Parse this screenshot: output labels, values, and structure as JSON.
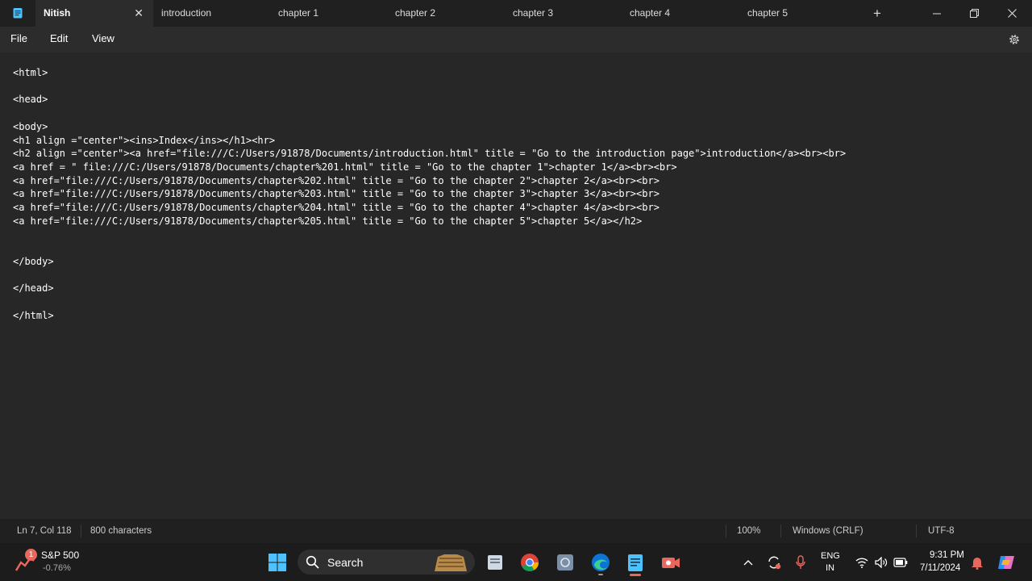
{
  "titlebar": {
    "tabs": [
      {
        "label": "Nitish",
        "active": true
      },
      {
        "label": "introduction"
      },
      {
        "label": "chapter 1"
      },
      {
        "label": "chapter 2"
      },
      {
        "label": "chapter 3"
      },
      {
        "label": "chapter 4"
      },
      {
        "label": "chapter 5"
      }
    ],
    "close_tab_glyph": "✕",
    "new_tab_glyph": "+"
  },
  "menu": {
    "file": "File",
    "edit": "Edit",
    "view": "View"
  },
  "editor": {
    "lines": [
      "<html>",
      "",
      "<head>",
      "",
      "<body>",
      "<h1 align =\"center\"><ins>Index</ins></h1><hr>",
      "<h2 align =\"center\"><a href=\"file:///C:/Users/91878/Documents/introduction.html\" title = \"Go to the introduction page\">introduction</a><br><br>",
      "<a href = \" file:///C:/Users/91878/Documents/chapter%201.html\" title = \"Go to the chapter 1\">chapter 1</a><br><br>",
      "<a href=\"file:///C:/Users/91878/Documents/chapter%202.html\" title = \"Go to the chapter 2\">chapter 2</a><br><br>",
      "<a href=\"file:///C:/Users/91878/Documents/chapter%203.html\" title = \"Go to the chapter 3\">chapter 3</a><br><br>",
      "<a href=\"file:///C:/Users/91878/Documents/chapter%204.html\" title = \"Go to the chapter 4\">chapter 4</a><br><br>",
      "<a href=\"file:///C:/Users/91878/Documents/chapter%205.html\" title = \"Go to the chapter 5\">chapter 5</a></h2>",
      "",
      "",
      "</body>",
      "",
      "</head>",
      "",
      "</html>"
    ]
  },
  "status": {
    "position": "Ln 7, Col 118",
    "characters": "800 characters",
    "zoom": "100%",
    "line_ending": "Windows (CRLF)",
    "encoding": "UTF-8"
  },
  "taskbar": {
    "stock_name": "S&P 500",
    "stock_change": "-0.76%",
    "stock_badge": "1",
    "search_label": "Search",
    "lang_top": "ENG",
    "lang_bottom": "IN",
    "time": "9:31 PM",
    "date": "7/11/2024"
  },
  "colors": {
    "accent": "#4cc2ff",
    "editor_bg": "#272727",
    "titlebar_bg": "#202020",
    "stock_negative": "#e8685e"
  },
  "icons": [
    "notepad-app-icon",
    "settings-gear-icon",
    "windows-start-icon",
    "search-icon",
    "widget-icon",
    "file-explorer-icon",
    "chrome-icon",
    "files-icon",
    "edge-icon",
    "notepad-icon",
    "recorder-icon",
    "chevron-up-icon",
    "sync-icon",
    "microphone-icon",
    "wifi-icon",
    "speaker-icon",
    "battery-icon",
    "notification-bell-icon",
    "copilot-icon"
  ]
}
